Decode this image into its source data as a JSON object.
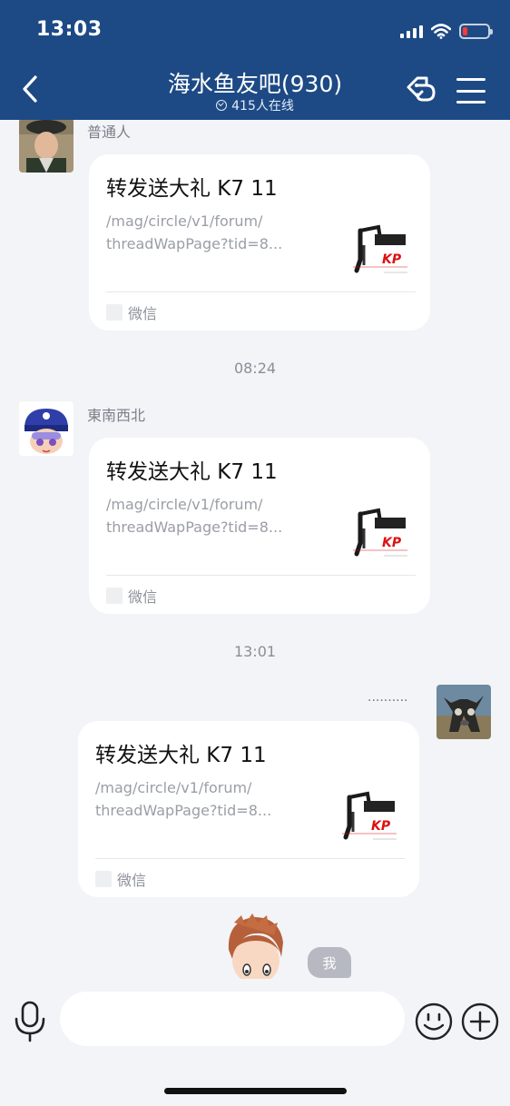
{
  "status_bar": {
    "time": "13:03"
  },
  "nav": {
    "title": "海水鱼友吧(930)",
    "online_count": "415人在线",
    "colors": {
      "header_bg": "#1d4a85",
      "battery_low": "#ff3b30"
    }
  },
  "messages": [
    {
      "sender": "普通人",
      "card": {
        "title": "转发送大礼 K7 11",
        "desc_line1": "/mag/circle/v1/forum/",
        "desc_line2": "threadWapPage?tid=8...",
        "source": "微信",
        "thumb_logo": "KP"
      }
    },
    {
      "timestamp": "08:24",
      "sender": "東南西北",
      "card": {
        "title": "转发送大礼 K7 11",
        "desc_line1": "/mag/circle/v1/forum/",
        "desc_line2": "threadWapPage?tid=8...",
        "source": "微信",
        "thumb_logo": "KP"
      }
    },
    {
      "timestamp": "13:01",
      "sender": "..........",
      "card": {
        "title": "转发送大礼 K7 11",
        "desc_line1": "/mag/circle/v1/forum/",
        "desc_line2": "threadWapPage?tid=8...",
        "source": "微信",
        "thumb_logo": "KP"
      }
    }
  ],
  "me_badge": "我",
  "input": {
    "value": "",
    "placeholder": ""
  }
}
